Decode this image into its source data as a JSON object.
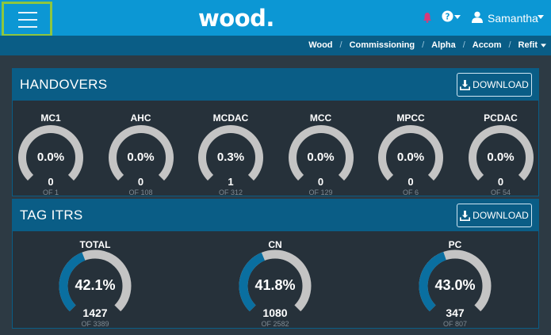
{
  "nav": {
    "brand": "wood.",
    "user_name": "Samantha"
  },
  "breadcrumb": [
    "Wood",
    "Commissioning",
    "Alpha",
    "Accom",
    "Refit"
  ],
  "colors": {
    "topbar": "#0c97d4",
    "header": "#0a5d86",
    "gauge_track": "#c4c4c4",
    "gauge_fill": "#0a6fa0",
    "menu_highlight": "#8dc63f",
    "bell": "#d63a7a"
  },
  "handovers": {
    "title": "HANDOVERS",
    "download_label": "DOWNLOAD",
    "gauges": [
      {
        "label": "MC1",
        "percent": "0.0%",
        "value": 0.0,
        "count": "0",
        "of": "OF 1"
      },
      {
        "label": "AHC",
        "percent": "0.0%",
        "value": 0.0,
        "count": "0",
        "of": "OF 108"
      },
      {
        "label": "MCDAC",
        "percent": "0.3%",
        "value": 0.3,
        "count": "1",
        "of": "OF 312"
      },
      {
        "label": "MCC",
        "percent": "0.0%",
        "value": 0.0,
        "count": "0",
        "of": "OF 129"
      },
      {
        "label": "MPCC",
        "percent": "0.0%",
        "value": 0.0,
        "count": "0",
        "of": "OF 6"
      },
      {
        "label": "PCDAC",
        "percent": "0.0%",
        "value": 0.0,
        "count": "0",
        "of": "OF 54"
      }
    ]
  },
  "tag_itrs": {
    "title": "TAG ITRS",
    "download_label": "DOWNLOAD",
    "gauges": [
      {
        "label": "TOTAL",
        "percent": "42.1%",
        "value": 42.1,
        "count": "1427",
        "of": "OF 3389"
      },
      {
        "label": "CN",
        "percent": "41.8%",
        "value": 41.8,
        "count": "1080",
        "of": "OF 2582"
      },
      {
        "label": "PC",
        "percent": "43.0%",
        "value": 43.0,
        "count": "347",
        "of": "OF 807"
      }
    ]
  }
}
